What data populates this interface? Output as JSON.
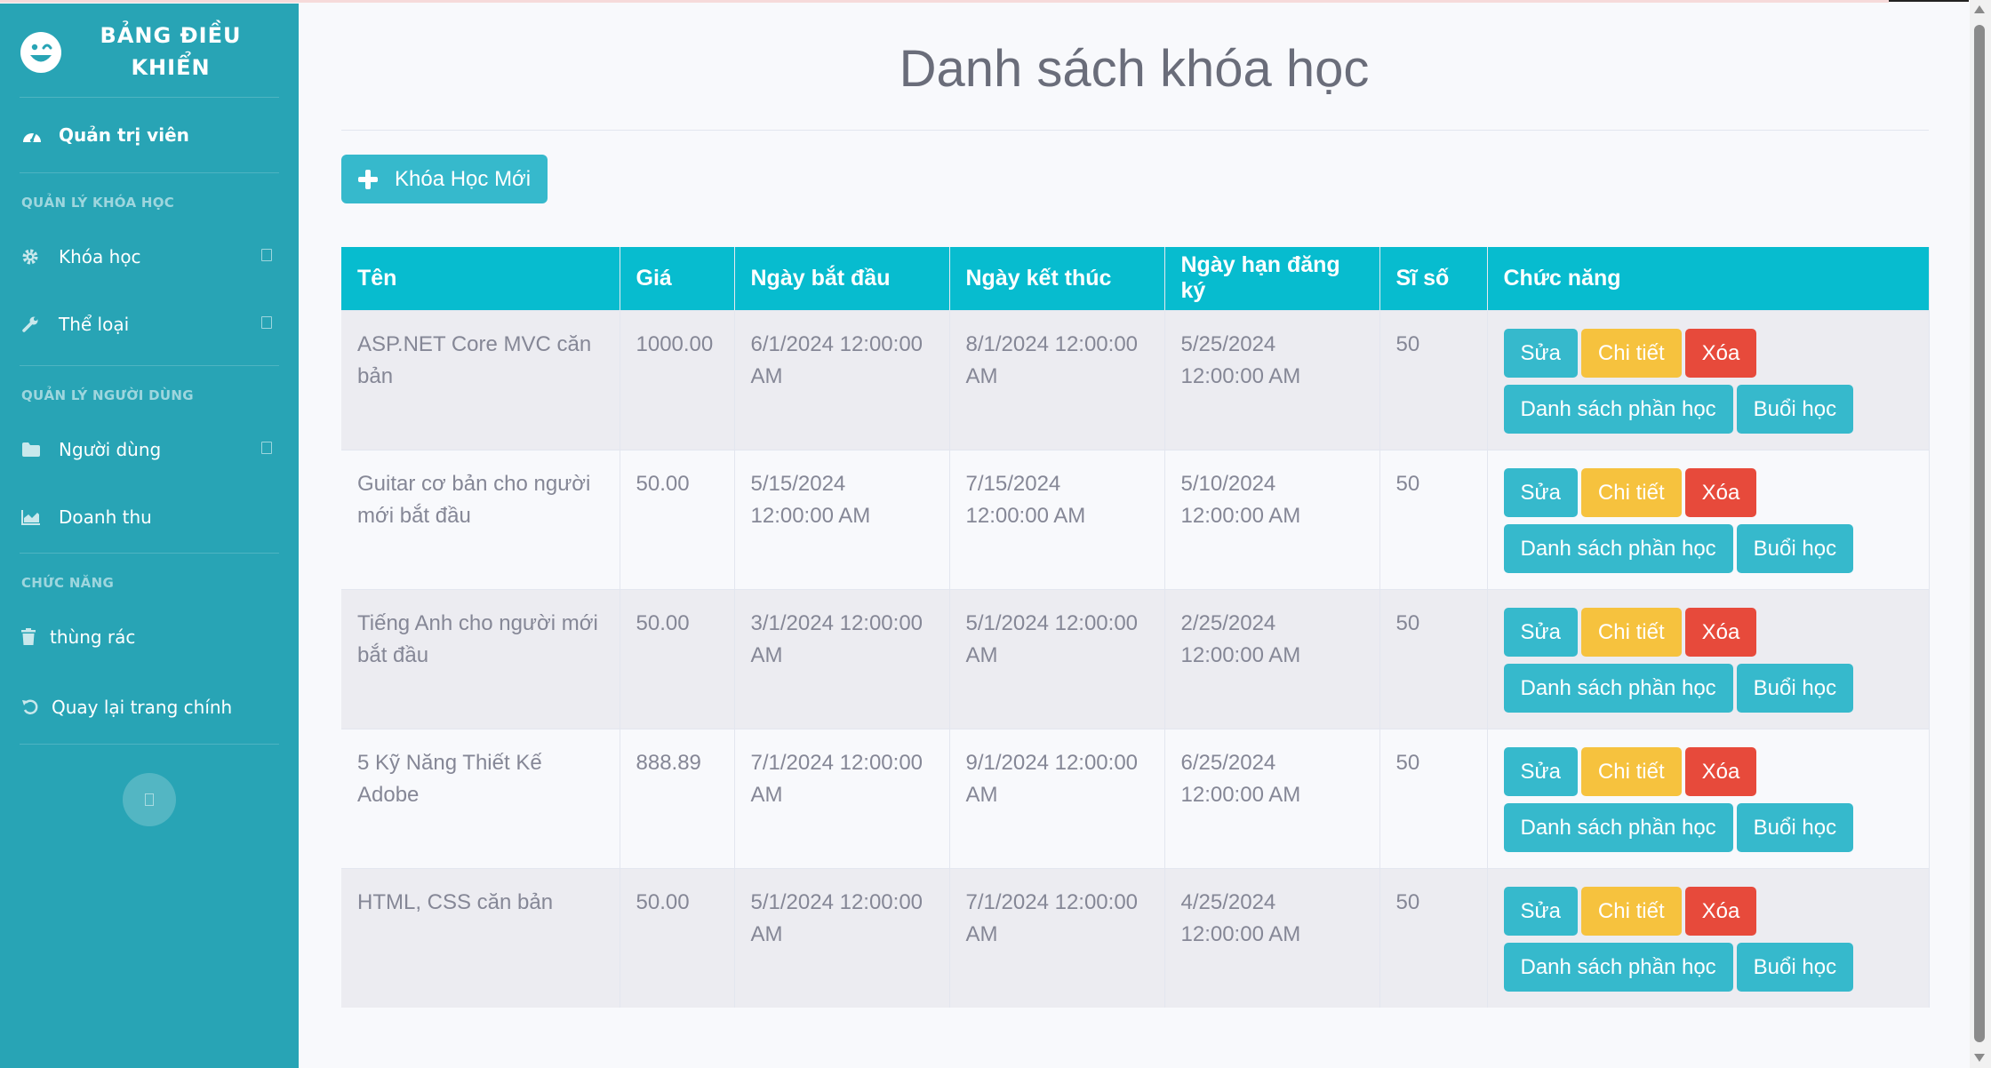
{
  "sidebar": {
    "brand": "BẢNG ĐIỀU KHIỂN",
    "brand_icon": "laugh-wink-icon",
    "admin_label": "Quản trị viên",
    "heading_courses": "QUẢN LÝ KHÓA HỌC",
    "item_courses": "Khóa học",
    "item_categories": "Thể loại",
    "heading_users": "QUẢN LÝ NGƯỜI DÙNG",
    "item_users": "Người dùng",
    "item_revenue": "Doanh thu",
    "heading_functions": "CHỨC NĂNG",
    "item_trash": "thùng rác",
    "item_back": "Quay lại trang chính"
  },
  "main": {
    "title": "Danh sách khóa học",
    "new_button": "Khóa Học Mới"
  },
  "table": {
    "columns": [
      "Tên",
      "Giá",
      "Ngày bắt đầu",
      "Ngày kết thúc",
      "Ngày hạn đăng ký",
      "Sĩ số",
      "Chức năng"
    ],
    "rows": [
      {
        "name": "ASP.NET Core MVC căn bản",
        "price": "1000.00",
        "start": "6/1/2024 12:00:00 AM",
        "end": "8/1/2024 12:00:00 AM",
        "deadline": "5/25/2024 12:00:00 AM",
        "size": "50"
      },
      {
        "name": "Guitar cơ bản cho người mới bắt đầu",
        "price": "50.00",
        "start": "5/15/2024 12:00:00 AM",
        "end": "7/15/2024 12:00:00 AM",
        "deadline": "5/10/2024 12:00:00 AM",
        "size": "50"
      },
      {
        "name": "Tiếng Anh cho người mới bắt đầu",
        "price": "50.00",
        "start": "3/1/2024 12:00:00 AM",
        "end": "5/1/2024 12:00:00 AM",
        "deadline": "2/25/2024 12:00:00 AM",
        "size": "50"
      },
      {
        "name": "5 Kỹ Năng Thiết Kế Adobe",
        "price": "888.89",
        "start": "7/1/2024 12:00:00 AM",
        "end": "9/1/2024 12:00:00 AM",
        "deadline": "6/25/2024 12:00:00 AM",
        "size": "50"
      },
      {
        "name": "HTML, CSS căn bản",
        "price": "50.00",
        "start": "5/1/2024 12:00:00 AM",
        "end": "7/1/2024 12:00:00 AM",
        "deadline": "4/25/2024 12:00:00 AM",
        "size": "50"
      }
    ],
    "actions": {
      "edit": "Sửa",
      "detail": "Chi tiết",
      "delete": "Xóa",
      "sections": "Danh sách phần học",
      "lessons": "Buổi học"
    }
  },
  "colors": {
    "sidebar": "#28a4b5",
    "table_header": "#07bccf",
    "info": "#36b9cc",
    "warning": "#f6c23e",
    "danger": "#e74a3b"
  }
}
